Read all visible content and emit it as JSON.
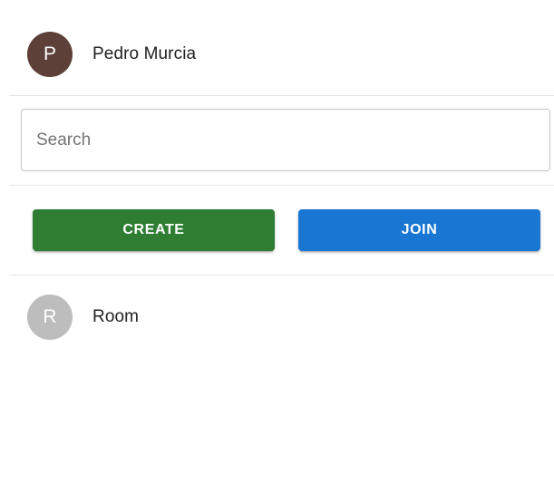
{
  "user": {
    "initial": "P",
    "name": "Pedro Murcia",
    "avatar_color": "#5d4037"
  },
  "search": {
    "placeholder": "Search",
    "value": ""
  },
  "actions": {
    "create_label": "CREATE",
    "join_label": "JOIN",
    "create_color": "#2e7d32",
    "join_color": "#1976d2"
  },
  "rooms": [
    {
      "initial": "R",
      "name": "Room",
      "avatar_color": "#bdbdbd"
    }
  ]
}
